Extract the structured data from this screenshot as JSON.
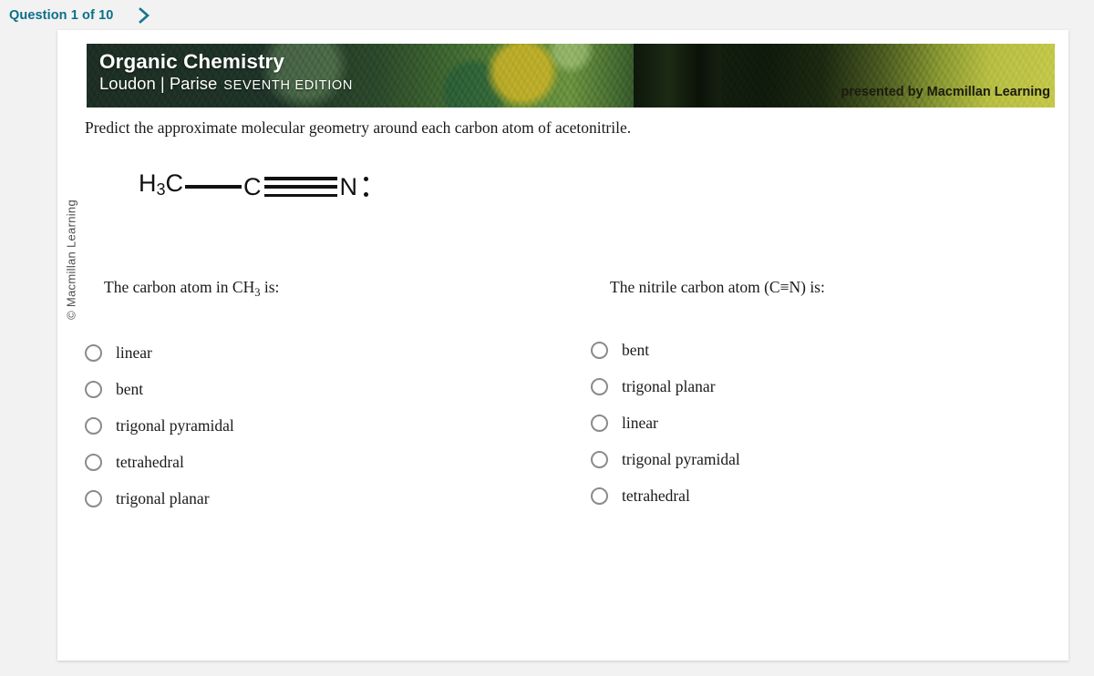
{
  "topbar": {
    "question_counter": "Question 1 of 10",
    "next_icon": "chevron-right-icon",
    "accent_color": "#0b6f8a"
  },
  "copyright": {
    "text": "© Macmillan Learning"
  },
  "banner": {
    "title": "Organic Chemistry",
    "authors": "Loudon | Parise",
    "edition": "SEVENTH EDITION",
    "presented_by": "presented by Macmillan Learning",
    "left_color": "#1f3026",
    "right_color": "#c6c94e"
  },
  "question": {
    "text": "Predict the approximate molecular geometry around each carbon atom of acetonitrile.",
    "molecule": {
      "atom1": "H₃C",
      "bond1": "single-bond",
      "atom2": "C",
      "bond2": "triple-bond",
      "atom3": "N",
      "lone_pair": "lone-pair-dots"
    }
  },
  "answers": {
    "columns": [
      {
        "prompt_prefix": "The carbon atom in CH",
        "prompt_sub": "3",
        "prompt_suffix": " is:",
        "options": [
          {
            "label": "linear",
            "selected": false
          },
          {
            "label": "bent",
            "selected": false
          },
          {
            "label": "trigonal pyramidal",
            "selected": false
          },
          {
            "label": "tetrahedral",
            "selected": false
          },
          {
            "label": "trigonal planar",
            "selected": false
          }
        ]
      },
      {
        "prompt_prefix": "The nitrile carbon atom (C≡N) is:",
        "prompt_sub": "",
        "prompt_suffix": "",
        "options": [
          {
            "label": "bent",
            "selected": false
          },
          {
            "label": "trigonal planar",
            "selected": false
          },
          {
            "label": "linear",
            "selected": false
          },
          {
            "label": "trigonal pyramidal",
            "selected": false
          },
          {
            "label": "tetrahedral",
            "selected": false
          }
        ]
      }
    ]
  }
}
